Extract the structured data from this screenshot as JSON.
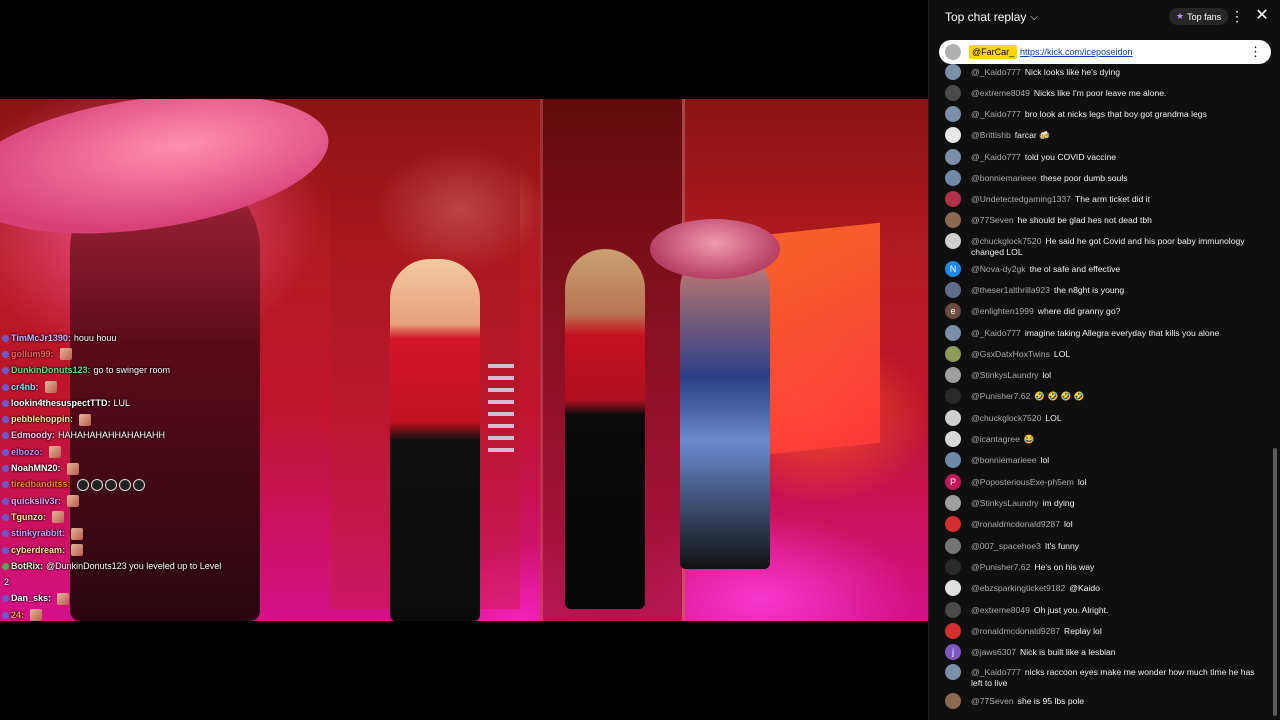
{
  "chat_panel": {
    "title": "Top chat replay",
    "chevron_icon": "chevron-down-icon",
    "top_fans_label": "Top fans",
    "pinned": {
      "user": "@FarCar_",
      "link": "https://kick.com/iceposeidon"
    },
    "messages": [
      {
        "user": "@_Kaido777",
        "text": "Nick looks like he's dying",
        "avatar_color": "#7b8fa8",
        "avatar_icon": "cartoon-avatar"
      },
      {
        "user": "@extreme8049",
        "text": "Nicks like I'm poor leave me alone.",
        "avatar_color": "#4a4a4a",
        "avatar_icon": "car-avatar"
      },
      {
        "user": "@_Kaido777",
        "text": "bro look at nicks legs that boy got grandma legs",
        "avatar_color": "#7b8fa8",
        "avatar_icon": "cartoon-avatar"
      },
      {
        "user": "@Brittishb",
        "text": "farcar 🍻",
        "avatar_color": "#e8e8e8",
        "avatar_icon": "panda-avatar"
      },
      {
        "user": "@_Kaido777",
        "text": "told you COVID vaccine",
        "avatar_color": "#7b8fa8",
        "avatar_icon": "cartoon-avatar"
      },
      {
        "user": "@bonniemarieee",
        "text": "these poor dumb souls",
        "avatar_color": "#6f8aa6",
        "avatar_icon": "photo-avatar"
      },
      {
        "user": "@Undetectedgaming1337",
        "text": "The arm ticket did it",
        "avatar_color": "#b0304a",
        "avatar_icon": "photo-avatar"
      },
      {
        "user": "@77Seven",
        "text": "he should be glad hes not dead tbh",
        "avatar_color": "#8a6a50",
        "avatar_icon": "photo-avatar"
      },
      {
        "user": "@chuckglock7520",
        "text": "He said he got Covid and his poor baby immunology changed LOL",
        "avatar_color": "#cfcfcf",
        "avatar_icon": "photo-avatar"
      },
      {
        "user": "@Nova-dy2gk",
        "text": "the ol safe and effective",
        "avatar_color": "#1e88e5",
        "avatar_letter": "N"
      },
      {
        "user": "@theser1althrilla923",
        "text": "the n8ght is young",
        "avatar_color": "#5d6d8a",
        "avatar_icon": "photo-avatar"
      },
      {
        "user": "@enlighten1999",
        "text": "where did granny go?",
        "avatar_color": "#6d4c41",
        "avatar_letter": "e"
      },
      {
        "user": "@_Kaido777",
        "text": "imagine taking Allegra everyday that kills you alone",
        "avatar_color": "#7b8fa8",
        "avatar_icon": "cartoon-avatar"
      },
      {
        "user": "@GsxDatxHoxTwins",
        "text": "LOL",
        "avatar_color": "#8c9a5a",
        "avatar_icon": "photo-avatar"
      },
      {
        "user": "@StinkysLaundry",
        "text": "lol",
        "avatar_color": "#9e9e9e",
        "avatar_icon": "gear-avatar"
      },
      {
        "user": "@Punisher7.62",
        "text": "🤣 🤣 🤣 🤣",
        "avatar_color": "#2a2a2a",
        "avatar_icon": "skull-avatar"
      },
      {
        "user": "@chuckglock7520",
        "text": "LOL",
        "avatar_color": "#cfcfcf",
        "avatar_icon": "photo-avatar"
      },
      {
        "user": "@icantagree",
        "text": "😂",
        "avatar_color": "#d9d9d9",
        "avatar_icon": "photo-avatar"
      },
      {
        "user": "@bonniemarieee",
        "text": "lol",
        "avatar_color": "#6f8aa6",
        "avatar_icon": "photo-avatar"
      },
      {
        "user": "@PoposteriousExe-ph5em",
        "text": "lol",
        "avatar_color": "#c2185b",
        "avatar_letter": "P"
      },
      {
        "user": "@StinkysLaundry",
        "text": "im dying",
        "avatar_color": "#9e9e9e",
        "avatar_icon": "gear-avatar"
      },
      {
        "user": "@ronaldmcdonald9287",
        "text": "lol",
        "avatar_color": "#d32f2f",
        "avatar_icon": "clown-avatar"
      },
      {
        "user": "@007_spacehoe3",
        "text": "It's funny",
        "avatar_color": "#757575",
        "avatar_icon": "photo-avatar"
      },
      {
        "user": "@Punisher7.62",
        "text": "He's on his way",
        "avatar_color": "#2a2a2a",
        "avatar_icon": "skull-avatar"
      },
      {
        "user": "@ebzsparkingticket9182",
        "text": "@Kaido",
        "avatar_color": "#e0e0e0",
        "avatar_icon": "photo-avatar"
      },
      {
        "user": "@extreme8049",
        "text": "Oh just you. Alright.",
        "avatar_color": "#4a4a4a",
        "avatar_icon": "car-avatar"
      },
      {
        "user": "@ronaldmcdonald9287",
        "text": "Replay lol",
        "avatar_color": "#d32f2f",
        "avatar_icon": "clown-avatar"
      },
      {
        "user": "@jaws6307",
        "text": "Nick is built like a lesbian",
        "avatar_color": "#7e57c2",
        "avatar_letter": "j"
      },
      {
        "user": "@_Kaido777",
        "text": "nicks raccoon eyes make me wonder how much time he has left to live",
        "avatar_color": "#7b8fa8",
        "avatar_icon": "cartoon-avatar"
      },
      {
        "user": "@77Seven",
        "text": "she is 95 lbs pole",
        "avatar_color": "#8a6a50",
        "avatar_icon": "photo-avatar"
      }
    ]
  },
  "stream_chat": [
    {
      "user": "TimMcJr1390:",
      "text": "houu houu",
      "color": "#c8b3ff",
      "emote": false
    },
    {
      "user": "gollum99:",
      "text": "",
      "color": "#ff5a5a",
      "emote": true
    },
    {
      "user": "DunkinDonuts123:",
      "text": "go to swinger room",
      "color": "#5fe07a",
      "emote": false
    },
    {
      "user": "cr4nb:",
      "text": "",
      "color": "#7de3ff",
      "emote": true
    },
    {
      "user": "lookin4thesuspectTTD:",
      "text": "LUL",
      "color": "#ffffff",
      "emote": false
    },
    {
      "user": "pebblehoppin:",
      "text": "",
      "color": "#ffe98a",
      "emote": true
    },
    {
      "user": "Edmoody:",
      "text": "HAHAHAHAHHAHAHAHH",
      "color": "#ffc2f0",
      "emote": false
    },
    {
      "user": "elbozo:",
      "text": "",
      "color": "#b98cff",
      "emote": true
    },
    {
      "user": "NoahMN20:",
      "text": "",
      "color": "#ffffff",
      "emote": true
    },
    {
      "user": "tiredbanditss:",
      "text": "",
      "color": "#ff7a3a",
      "emote": false,
      "circles": true
    },
    {
      "user": "quicksilv3r:",
      "text": "",
      "color": "#e0a0ff",
      "emote": true
    },
    {
      "user": "Tgunzo:",
      "text": "",
      "color": "#ffe98a",
      "emote": true
    },
    {
      "user": "stinkyrabbit:",
      "text": "",
      "color": "#c0a0ff",
      "emote": true
    },
    {
      "user": "cyberdream:",
      "text": "",
      "color": "#ffe98a",
      "emote": true
    },
    {
      "user": "BotRix:",
      "text": "@DunkinDonuts123 you leveled up to Level",
      "color": "#c8ffc8",
      "emote": false,
      "bot": true
    },
    {
      "user": "",
      "text": "2",
      "color": "#ffffff",
      "emote": false,
      "cont": true
    },
    {
      "user": "Dan_sks:",
      "text": "",
      "color": "#ffffff",
      "emote": true
    },
    {
      "user": "24:",
      "text": "",
      "color": "#ff9a5a",
      "emote": true
    }
  ]
}
